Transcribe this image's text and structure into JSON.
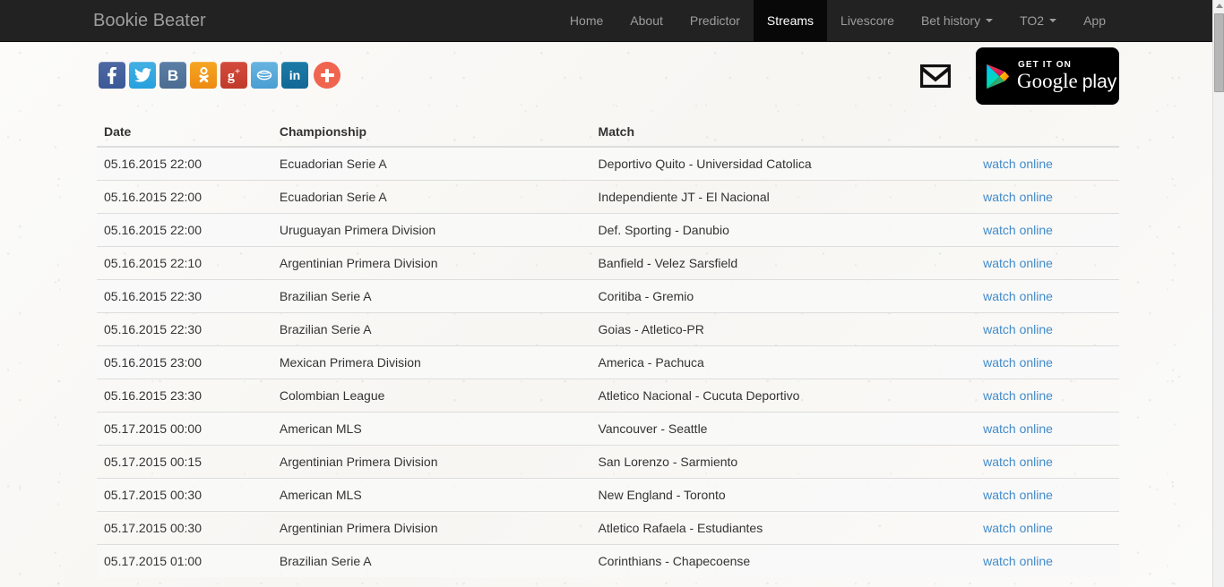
{
  "navbar": {
    "brand": "Bookie Beater",
    "items": [
      {
        "label": "Home",
        "active": false,
        "caret": false
      },
      {
        "label": "About",
        "active": false,
        "caret": false
      },
      {
        "label": "Predictor",
        "active": false,
        "caret": false
      },
      {
        "label": "Streams",
        "active": true,
        "caret": false
      },
      {
        "label": "Livescore",
        "active": false,
        "caret": false
      },
      {
        "label": "Bet history",
        "active": false,
        "caret": true
      },
      {
        "label": "TO2",
        "active": false,
        "caret": true
      },
      {
        "label": "App",
        "active": false,
        "caret": false
      }
    ],
    "brand_color": "#9d9d9d",
    "bg_color": "#222222",
    "active_bg": "#080808"
  },
  "social": {
    "buttons": [
      {
        "name": "facebook-share-button",
        "glyph": "f",
        "title": "Facebook"
      },
      {
        "name": "twitter-share-button",
        "glyph": "",
        "title": "Twitter"
      },
      {
        "name": "vkontakte-share-button",
        "glyph": "B",
        "title": "VKontakte"
      },
      {
        "name": "odnoklassniki-share-button",
        "glyph": "",
        "title": "Odnoklassniki"
      },
      {
        "name": "googleplus-share-button",
        "glyph": "g+",
        "title": "Google Plus"
      },
      {
        "name": "surfingbird-share-button",
        "glyph": "",
        "title": "Surfingbird"
      },
      {
        "name": "linkedin-share-button",
        "glyph": "in",
        "title": "LinkedIn"
      },
      {
        "name": "more-share-button",
        "glyph": "+",
        "title": "More"
      }
    ]
  },
  "tools": {
    "mail_title": "Email",
    "google_play": {
      "get_it_on": "GET IT ON",
      "store_first": "Google",
      "store_second": "play"
    }
  },
  "table": {
    "headers": [
      "Date",
      "Championship",
      "Match",
      ""
    ],
    "link_label": "watch online",
    "link_color": "#428bca",
    "rows": [
      {
        "date": "05.16.2015 22:00",
        "championship": "Ecuadorian Serie A",
        "match": "Deportivo Quito - Universidad Catolica",
        "link": "watch online"
      },
      {
        "date": "05.16.2015 22:00",
        "championship": "Ecuadorian Serie A",
        "match": "Independiente JT - El Nacional",
        "link": "watch online"
      },
      {
        "date": "05.16.2015 22:00",
        "championship": "Uruguayan Primera Division",
        "match": "Def. Sporting - Danubio",
        "link": "watch online"
      },
      {
        "date": "05.16.2015 22:10",
        "championship": "Argentinian Primera Division",
        "match": "Banfield - Velez Sarsfield",
        "link": "watch online"
      },
      {
        "date": "05.16.2015 22:30",
        "championship": "Brazilian Serie A",
        "match": "Coritiba - Gremio",
        "link": "watch online"
      },
      {
        "date": "05.16.2015 22:30",
        "championship": "Brazilian Serie A",
        "match": "Goias - Atletico-PR",
        "link": "watch online"
      },
      {
        "date": "05.16.2015 23:00",
        "championship": "Mexican Primera Division",
        "match": "America - Pachuca",
        "link": "watch online"
      },
      {
        "date": "05.16.2015 23:30",
        "championship": "Colombian League",
        "match": "Atletico Nacional - Cucuta Deportivo",
        "link": "watch online"
      },
      {
        "date": "05.17.2015 00:00",
        "championship": "American MLS",
        "match": "Vancouver - Seattle",
        "link": "watch online"
      },
      {
        "date": "05.17.2015 00:15",
        "championship": "Argentinian Primera Division",
        "match": "San Lorenzo - Sarmiento",
        "link": "watch online"
      },
      {
        "date": "05.17.2015 00:30",
        "championship": "American MLS",
        "match": "New England - Toronto",
        "link": "watch online"
      },
      {
        "date": "05.17.2015 00:30",
        "championship": "Argentinian Primera Division",
        "match": "Atletico Rafaela - Estudiantes",
        "link": "watch online"
      },
      {
        "date": "05.17.2015 01:00",
        "championship": "Brazilian Serie A",
        "match": "Corinthians - Chapecoense",
        "link": "watch online"
      }
    ]
  }
}
